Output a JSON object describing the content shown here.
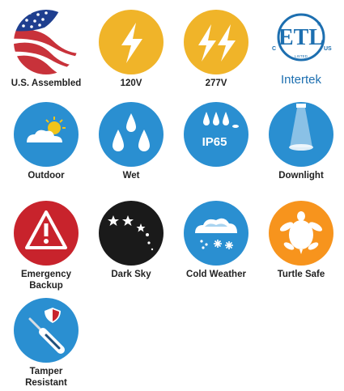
{
  "colors": {
    "yellow": "#f0b429",
    "blue": "#2a8fd1",
    "red": "#c8232c",
    "black": "#1a1a1a",
    "orange": "#f7941d",
    "etl_blue": "#1d6fb0",
    "flag_red": "#c8323a",
    "flag_blue": "#1f3f8f"
  },
  "badges": [
    {
      "label": "U.S. Assembled",
      "icon": "us-flag-icon"
    },
    {
      "label": "120V",
      "icon": "lightning-bolt-icon"
    },
    {
      "label": "277V",
      "icon": "double-lightning-bolt-icon"
    },
    {
      "label": "Intertek",
      "icon": "etl-listed-icon",
      "mark": {
        "letters": "ETL",
        "left": "C",
        "right": "US",
        "arc": "LISTED",
        "reg": "®"
      }
    },
    {
      "label": "Outdoor",
      "icon": "sun-cloud-icon"
    },
    {
      "label": "Wet",
      "icon": "water-drops-icon"
    },
    {
      "label": "",
      "icon": "ip65-drops-icon",
      "badge_text": "IP65"
    },
    {
      "label": "Downlight",
      "icon": "downlight-beam-icon"
    },
    {
      "label": "Emergency",
      "label2": "Backup",
      "icon": "warning-triangle-icon"
    },
    {
      "label": "Dark Sky",
      "icon": "stars-icon"
    },
    {
      "label": "Cold Weather",
      "icon": "snow-cloud-icon"
    },
    {
      "label": "Turtle Safe",
      "icon": "turtle-icon"
    },
    {
      "label": "Tamper",
      "label2": "Resistant",
      "icon": "screwdriver-shield-icon"
    }
  ]
}
